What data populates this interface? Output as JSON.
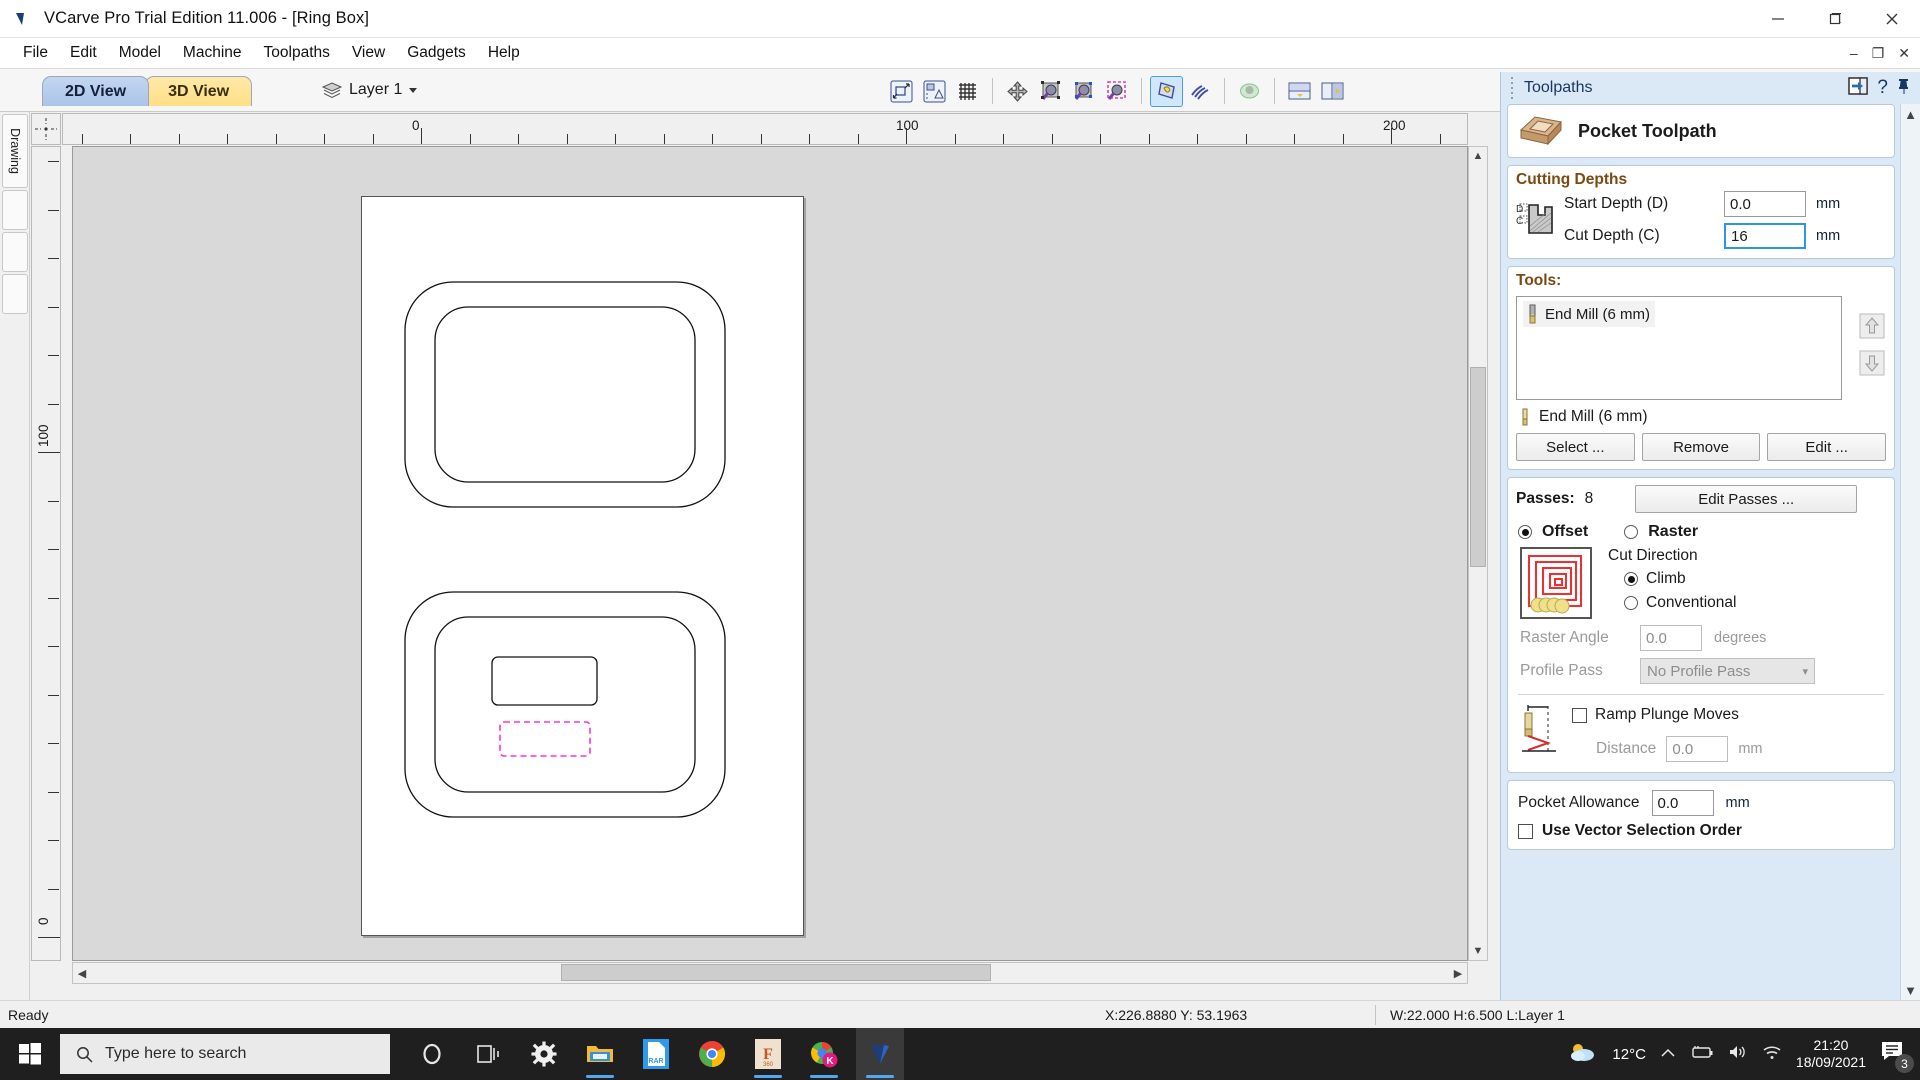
{
  "window": {
    "title": "VCarve Pro Trial Edition 11.006 - [Ring Box]",
    "app_icon": "vcarve-logo-icon",
    "minimize": "minimize-icon",
    "maximize": "maximize-icon",
    "close": "close-icon"
  },
  "menu": {
    "items": [
      "File",
      "Edit",
      "Model",
      "Machine",
      "Toolpaths",
      "View",
      "Gadgets",
      "Help"
    ],
    "doc_minimize": "–",
    "doc_restore": "❐",
    "doc_close": "✕"
  },
  "view_bar": {
    "tabs": [
      {
        "label": "2D View",
        "active": true
      },
      {
        "label": "3D View",
        "active": false
      }
    ],
    "layer": {
      "icon": "layers-icon",
      "label": "Layer 1",
      "caret": "chevron-down-icon"
    },
    "tools": [
      "zoom-to-selection-icon",
      "zoom-to-drawing-icon",
      "toggle-grid-icon",
      "pan-icon",
      "zoom-object-icon",
      "zoom-selected-icon",
      "zoom-dashed-icon",
      "toggle-toolpath-solid-icon",
      "toggle-toolpath-lines-icon",
      "toggle-3d-model-icon",
      "split-view-horizontal-icon",
      "split-view-vertical-icon"
    ]
  },
  "left_strip": {
    "tabs": [
      "Drawing",
      "",
      "",
      ""
    ]
  },
  "rulers": {
    "horizontal": {
      "labels": [
        "0",
        "100",
        "200"
      ]
    },
    "vertical": {
      "labels": [
        "100",
        "0"
      ]
    }
  },
  "canvas": {
    "drawing_name": "ring-box-vectors",
    "selected_vector_color": "#ff33cc"
  },
  "status_bar": {
    "ready": "Ready",
    "coordinates": "X:226.8880 Y: 53.1963",
    "dimensions": "W:22.000  H:6.500  L:Layer 1"
  },
  "toolpaths": {
    "panel_title": "Toolpaths",
    "header_icons": [
      "collapse-panel-icon",
      "help-icon",
      "pin-icon"
    ],
    "toolpath_type": {
      "icon": "pocket-toolpath-icon",
      "label": "Pocket Toolpath"
    },
    "cutting_depths": {
      "heading": "Cutting Depths",
      "icon": "depth-profile-icon",
      "start_depth": {
        "label": "Start Depth (D)",
        "value": "0.0",
        "unit": "mm"
      },
      "cut_depth": {
        "label": "Cut Depth (C)",
        "value": "16",
        "unit": "mm"
      }
    },
    "tools": {
      "heading": "Tools:",
      "list": [
        {
          "icon": "end-mill-icon",
          "label": "End Mill (6 mm)",
          "selected": true
        }
      ],
      "move_up": "arrow-up-icon",
      "move_down": "arrow-down-icon",
      "current_tool": {
        "icon": "end-mill-icon",
        "label": "End Mill (6 mm)"
      },
      "buttons": [
        "Select ...",
        "Remove",
        "Edit ..."
      ]
    },
    "passes": {
      "label": "Passes:",
      "value": "8",
      "edit_button": "Edit Passes ..."
    },
    "strategy": {
      "offset": {
        "label": "Offset",
        "selected": true
      },
      "raster": {
        "label": "Raster",
        "selected": false
      },
      "preview_icon": "offset-pattern-icon",
      "cut_direction": {
        "label": "Cut Direction",
        "climb": {
          "label": "Climb",
          "selected": true
        },
        "conventional": {
          "label": "Conventional",
          "selected": false
        }
      },
      "raster_angle": {
        "label": "Raster Angle",
        "value": "0.0",
        "unit": "degrees",
        "disabled": true
      },
      "profile_pass": {
        "label": "Profile Pass",
        "value": "No Profile Pass",
        "disabled": true
      }
    },
    "ramp": {
      "icon": "ramp-plunge-icon",
      "checkbox_label": "Ramp Plunge Moves",
      "checked": false,
      "distance": {
        "label": "Distance",
        "value": "0.0",
        "unit": "mm",
        "disabled": true
      }
    },
    "pocket": {
      "allowance": {
        "label": "Pocket Allowance",
        "value": "0.0",
        "unit": "mm"
      },
      "use_vector_order": {
        "label": "Use Vector Selection Order",
        "checked": false
      }
    },
    "scroll_up": "scroll-up-icon",
    "scroll_down": "scroll-down-icon"
  },
  "taskbar": {
    "start": "windows-start-icon",
    "search_placeholder": "Type here to search",
    "search_icon": "search-icon",
    "items": [
      {
        "name": "cortana-icon",
        "running": false
      },
      {
        "name": "task-view-icon",
        "running": false
      },
      {
        "name": "settings-icon",
        "running": false
      },
      {
        "name": "file-explorer-icon",
        "running": true
      },
      {
        "name": "winrar-icon",
        "running": false
      },
      {
        "name": "google-chrome-icon",
        "running": false
      },
      {
        "name": "fusion360-icon",
        "running": true
      },
      {
        "name": "chrome-kite-icon",
        "running": true
      },
      {
        "name": "vcarve-pro-icon",
        "running": true,
        "active": true
      }
    ],
    "tray": {
      "weather_icon": "partly-cloudy-icon",
      "temperature": "12°C",
      "chevron": "show-hidden-icons-icon",
      "battery": "battery-charging-icon",
      "volume": "volume-icon",
      "network": "wifi-icon",
      "time": "21:20",
      "date": "18/09/2021",
      "notifications": {
        "icon": "notifications-icon",
        "count": "3"
      }
    }
  }
}
